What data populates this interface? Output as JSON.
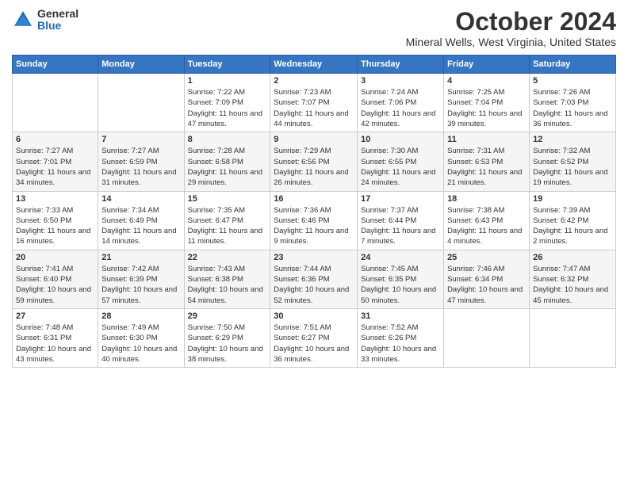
{
  "logo": {
    "general": "General",
    "blue": "Blue"
  },
  "header": {
    "month": "October 2024",
    "location": "Mineral Wells, West Virginia, United States"
  },
  "weekdays": [
    "Sunday",
    "Monday",
    "Tuesday",
    "Wednesday",
    "Thursday",
    "Friday",
    "Saturday"
  ],
  "weeks": [
    [
      {
        "day": "",
        "info": ""
      },
      {
        "day": "",
        "info": ""
      },
      {
        "day": "1",
        "info": "Sunrise: 7:22 AM\nSunset: 7:09 PM\nDaylight: 11 hours and 47 minutes."
      },
      {
        "day": "2",
        "info": "Sunrise: 7:23 AM\nSunset: 7:07 PM\nDaylight: 11 hours and 44 minutes."
      },
      {
        "day": "3",
        "info": "Sunrise: 7:24 AM\nSunset: 7:06 PM\nDaylight: 11 hours and 42 minutes."
      },
      {
        "day": "4",
        "info": "Sunrise: 7:25 AM\nSunset: 7:04 PM\nDaylight: 11 hours and 39 minutes."
      },
      {
        "day": "5",
        "info": "Sunrise: 7:26 AM\nSunset: 7:03 PM\nDaylight: 11 hours and 36 minutes."
      }
    ],
    [
      {
        "day": "6",
        "info": "Sunrise: 7:27 AM\nSunset: 7:01 PM\nDaylight: 11 hours and 34 minutes."
      },
      {
        "day": "7",
        "info": "Sunrise: 7:27 AM\nSunset: 6:59 PM\nDaylight: 11 hours and 31 minutes."
      },
      {
        "day": "8",
        "info": "Sunrise: 7:28 AM\nSunset: 6:58 PM\nDaylight: 11 hours and 29 minutes."
      },
      {
        "day": "9",
        "info": "Sunrise: 7:29 AM\nSunset: 6:56 PM\nDaylight: 11 hours and 26 minutes."
      },
      {
        "day": "10",
        "info": "Sunrise: 7:30 AM\nSunset: 6:55 PM\nDaylight: 11 hours and 24 minutes."
      },
      {
        "day": "11",
        "info": "Sunrise: 7:31 AM\nSunset: 6:53 PM\nDaylight: 11 hours and 21 minutes."
      },
      {
        "day": "12",
        "info": "Sunrise: 7:32 AM\nSunset: 6:52 PM\nDaylight: 11 hours and 19 minutes."
      }
    ],
    [
      {
        "day": "13",
        "info": "Sunrise: 7:33 AM\nSunset: 6:50 PM\nDaylight: 11 hours and 16 minutes."
      },
      {
        "day": "14",
        "info": "Sunrise: 7:34 AM\nSunset: 6:49 PM\nDaylight: 11 hours and 14 minutes."
      },
      {
        "day": "15",
        "info": "Sunrise: 7:35 AM\nSunset: 6:47 PM\nDaylight: 11 hours and 11 minutes."
      },
      {
        "day": "16",
        "info": "Sunrise: 7:36 AM\nSunset: 6:46 PM\nDaylight: 11 hours and 9 minutes."
      },
      {
        "day": "17",
        "info": "Sunrise: 7:37 AM\nSunset: 6:44 PM\nDaylight: 11 hours and 7 minutes."
      },
      {
        "day": "18",
        "info": "Sunrise: 7:38 AM\nSunset: 6:43 PM\nDaylight: 11 hours and 4 minutes."
      },
      {
        "day": "19",
        "info": "Sunrise: 7:39 AM\nSunset: 6:42 PM\nDaylight: 11 hours and 2 minutes."
      }
    ],
    [
      {
        "day": "20",
        "info": "Sunrise: 7:41 AM\nSunset: 6:40 PM\nDaylight: 10 hours and 59 minutes."
      },
      {
        "day": "21",
        "info": "Sunrise: 7:42 AM\nSunset: 6:39 PM\nDaylight: 10 hours and 57 minutes."
      },
      {
        "day": "22",
        "info": "Sunrise: 7:43 AM\nSunset: 6:38 PM\nDaylight: 10 hours and 54 minutes."
      },
      {
        "day": "23",
        "info": "Sunrise: 7:44 AM\nSunset: 6:36 PM\nDaylight: 10 hours and 52 minutes."
      },
      {
        "day": "24",
        "info": "Sunrise: 7:45 AM\nSunset: 6:35 PM\nDaylight: 10 hours and 50 minutes."
      },
      {
        "day": "25",
        "info": "Sunrise: 7:46 AM\nSunset: 6:34 PM\nDaylight: 10 hours and 47 minutes."
      },
      {
        "day": "26",
        "info": "Sunrise: 7:47 AM\nSunset: 6:32 PM\nDaylight: 10 hours and 45 minutes."
      }
    ],
    [
      {
        "day": "27",
        "info": "Sunrise: 7:48 AM\nSunset: 6:31 PM\nDaylight: 10 hours and 43 minutes."
      },
      {
        "day": "28",
        "info": "Sunrise: 7:49 AM\nSunset: 6:30 PM\nDaylight: 10 hours and 40 minutes."
      },
      {
        "day": "29",
        "info": "Sunrise: 7:50 AM\nSunset: 6:29 PM\nDaylight: 10 hours and 38 minutes."
      },
      {
        "day": "30",
        "info": "Sunrise: 7:51 AM\nSunset: 6:27 PM\nDaylight: 10 hours and 36 minutes."
      },
      {
        "day": "31",
        "info": "Sunrise: 7:52 AM\nSunset: 6:26 PM\nDaylight: 10 hours and 33 minutes."
      },
      {
        "day": "",
        "info": ""
      },
      {
        "day": "",
        "info": ""
      }
    ]
  ]
}
